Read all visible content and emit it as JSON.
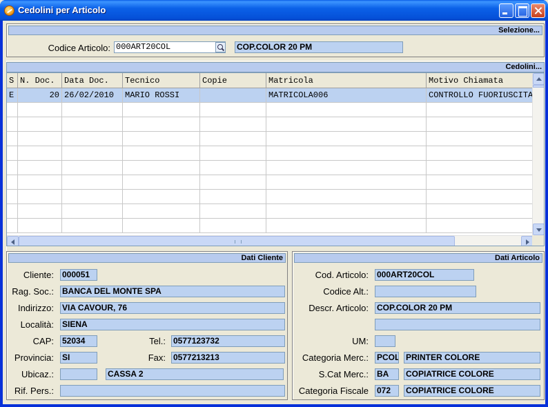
{
  "window": {
    "title": "Cedolini per Articolo"
  },
  "selection": {
    "header": "Selezione...",
    "codice_label": "Codice Articolo:",
    "codice_value": "000ART20COL",
    "description": "COP.COLOR 20 PM"
  },
  "grid": {
    "header": "Cedolini...",
    "columns": [
      "S",
      "N. Doc.",
      "Data Doc.",
      "Tecnico",
      "Copie",
      "Matricola",
      "Motivo Chiamata"
    ],
    "rows": [
      [
        "E",
        "20",
        "26/02/2010",
        "MARIO ROSSI",
        "",
        "MATRICOLA006",
        "CONTROLLO FUORIUSCITA"
      ]
    ],
    "empty_rows": 9
  },
  "cliente": {
    "header": "Dati Cliente",
    "cliente_label": "Cliente:",
    "cliente": "000051",
    "ragsoc_label": "Rag. Soc.:",
    "ragsoc": "BANCA DEL MONTE SPA",
    "indirizzo_label": "Indirizzo:",
    "indirizzo": "VIA CAVOUR, 76",
    "localita_label": "Località:",
    "localita": "SIENA",
    "cap_label": "CAP:",
    "cap": "52034",
    "tel_label": "Tel.:",
    "tel": "0577123732",
    "provincia_label": "Provincia:",
    "provincia": "SI",
    "fax_label": "Fax:",
    "fax": "0577213213",
    "ubicaz_label": "Ubicaz.:",
    "ubicaz_code": "",
    "ubicaz": "CASSA 2",
    "rifpers_label": "Rif. Pers.:",
    "rifpers": ""
  },
  "articolo": {
    "header": "Dati Articolo",
    "cod_label": "Cod. Articolo:",
    "cod": "000ART20COL",
    "alt_label": "Codice Alt.:",
    "alt": "",
    "descr_label": "Descr. Articolo:",
    "descr": "COP.COLOR 20 PM",
    "descr2": "",
    "um_label": "UM:",
    "um": "",
    "catmerc_label": "Categoria Merc.:",
    "catmerc_code": "PCOL",
    "catmerc": "PRINTER COLORE",
    "scat_label": "S.Cat Merc.:",
    "scat_code": "BA",
    "scat": "COPIATRICE COLORE",
    "catfisc_label": "Categoria Fiscale",
    "catfisc_code": "072",
    "catfisc": "COPIATRICE COLORE"
  }
}
